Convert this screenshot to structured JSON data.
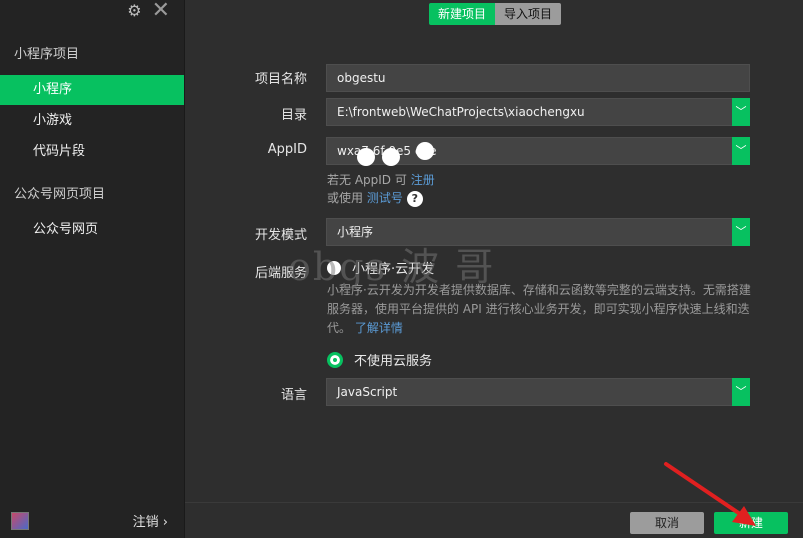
{
  "sidebar": {
    "section1_title": "小程序项目",
    "items1": [
      "小程序",
      "小游戏",
      "代码片段"
    ],
    "section2_title": "公众号网页项目",
    "items2": [
      "公众号网页"
    ],
    "logout": "注销 ›"
  },
  "tabs": {
    "new": "新建项目",
    "import": "导入项目"
  },
  "form": {
    "name_label": "项目名称",
    "name_value": "obgestu",
    "dir_label": "目录",
    "dir_value": "E:\\frontweb\\WeChatProjects\\xiaochengxu",
    "appid_label": "AppID",
    "appid_value": "wxa7 6f 0e5  c2e",
    "appid_hint_prefix": "若无 AppID 可",
    "appid_hint_link": "注册",
    "appid_hint2_prefix": "或使用",
    "appid_hint2_link": "测试号",
    "qmark": "?",
    "mode_label": "开发模式",
    "mode_value": "小程序",
    "backend_label": "后端服务",
    "backend_option1": "小程序·云开发",
    "backend_desc": "小程序·云开发为开发者提供数据库、存储和云函数等完整的云端支持。无需搭建服务器，使用平台提供的 API 进行核心业务开发，即可实现小程序快速上线和迭代。",
    "backend_desc_link": "了解详情",
    "backend_option2": "不使用云服务",
    "lang_label": "语言",
    "lang_value": "JavaScript"
  },
  "watermark": "obgs 波 哥",
  "footer": {
    "cancel": "取消",
    "create": "新建"
  },
  "colors": {
    "accent": "#07c160",
    "link": "#5b9bd5",
    "arrow": "#e02020"
  }
}
